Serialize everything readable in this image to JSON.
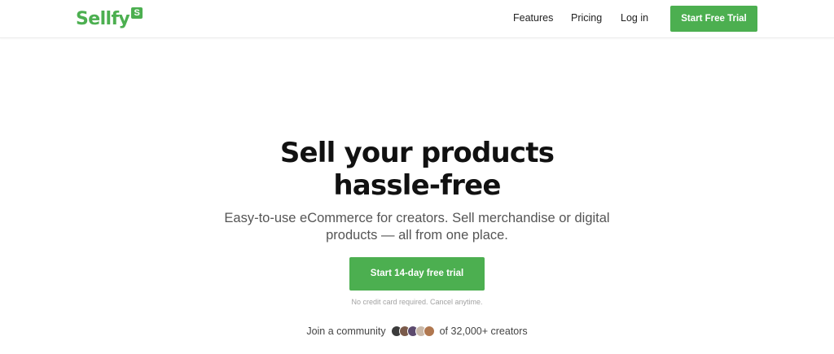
{
  "brand": {
    "name": "Sellfy",
    "badge": "S",
    "color": "#4caf50"
  },
  "nav": {
    "items": [
      {
        "label": "Features"
      },
      {
        "label": "Pricing"
      },
      {
        "label": "Log in"
      }
    ],
    "cta_label": "Start Free Trial"
  },
  "hero": {
    "title_line1": "Sell your products",
    "title_line2": "hassle-free",
    "subtitle_line1": "Easy-to-use eCommerce for creators. Sell merchandise or digital",
    "subtitle_line2": "products — all from one place.",
    "cta_label": "Start 14-day free trial",
    "note": "No credit card required. Cancel anytime."
  },
  "community": {
    "prefix": "Join a community",
    "suffix": "of 32,000+ creators",
    "avatar_colors": [
      "#3b3b3b",
      "#7a5a4a",
      "#5c4a6e",
      "#c9b8a8",
      "#b0774f"
    ]
  }
}
